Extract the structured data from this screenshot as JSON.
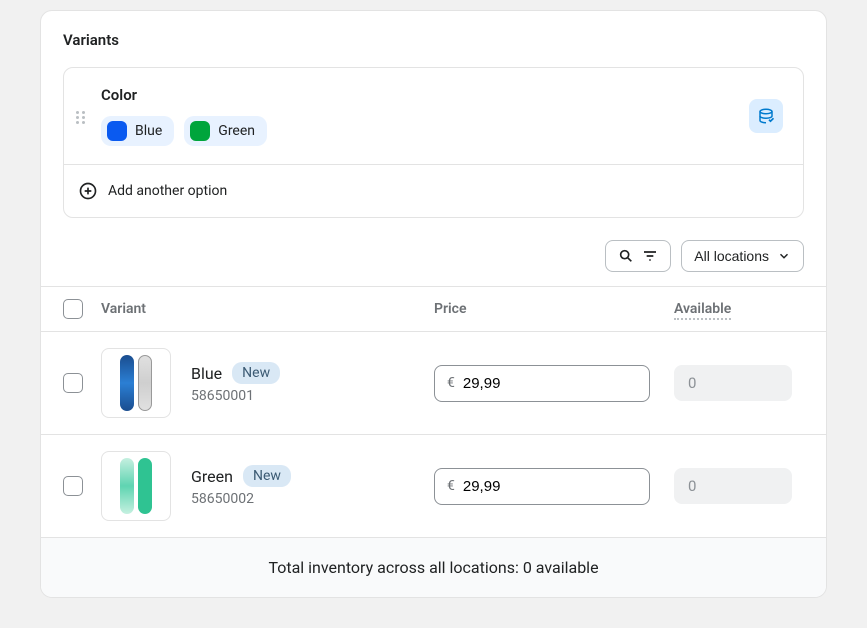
{
  "section_title": "Variants",
  "option": {
    "name": "Color",
    "values": [
      {
        "label": "Blue",
        "color": "#0a5af0"
      },
      {
        "label": "Green",
        "color": "#00a53c"
      }
    ]
  },
  "add_option_label": "Add another option",
  "location_filter": "All locations",
  "columns": {
    "variant": "Variant",
    "price": "Price",
    "available": "Available"
  },
  "currency_symbol": "€",
  "variants": [
    {
      "name": "Blue",
      "badge": "New",
      "sku": "58650001",
      "price": "29,99",
      "available": "0",
      "thumb_style": "blue"
    },
    {
      "name": "Green",
      "badge": "New",
      "sku": "58650002",
      "price": "29,99",
      "available": "0",
      "thumb_style": "green"
    }
  ],
  "footer_text": "Total inventory across all locations: 0 available"
}
